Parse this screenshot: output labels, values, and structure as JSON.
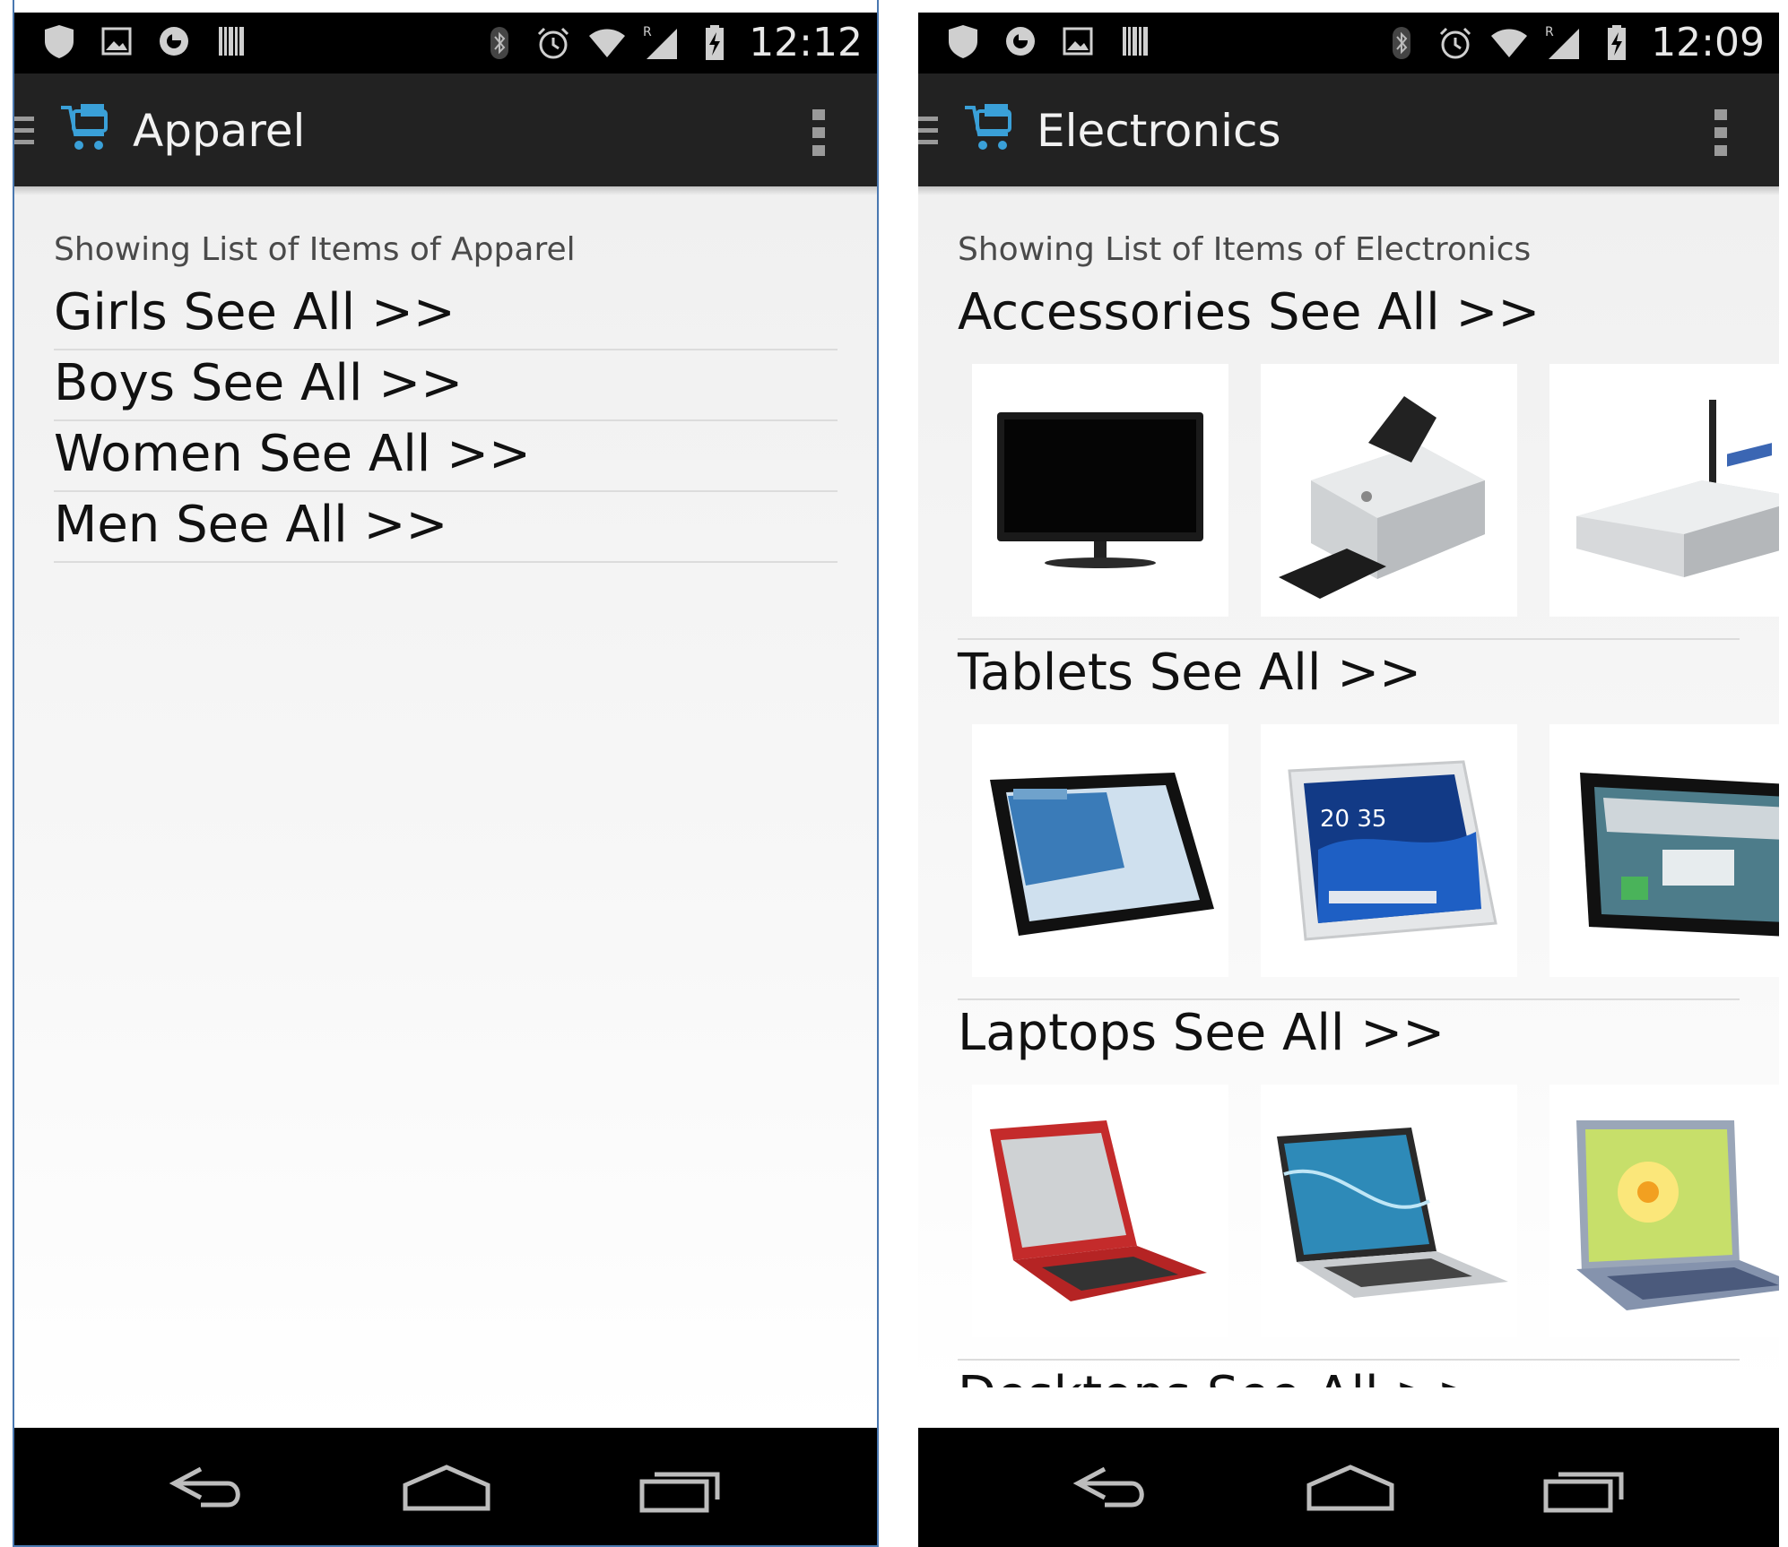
{
  "left": {
    "status": {
      "time": "12:12"
    },
    "action_bar": {
      "title": "Apparel"
    },
    "subtitle": "Showing List of Items of Apparel",
    "categories": [
      {
        "label": "Girls See All >>"
      },
      {
        "label": "Boys See All >>"
      },
      {
        "label": "Women See All >>"
      },
      {
        "label": "Men See All >>"
      }
    ]
  },
  "right": {
    "status": {
      "time": "12:09"
    },
    "action_bar": {
      "title": "Electronics"
    },
    "subtitle": "Showing List of Items of Electronics",
    "sections": [
      {
        "label": "Accessories See All >>",
        "items": [
          "tv-icon",
          "printer-icon",
          "router-icon"
        ]
      },
      {
        "label": "Tablets See All >>",
        "items": [
          "tablet-icon",
          "tablet-icon",
          "tablet-icon"
        ]
      },
      {
        "label": "Laptops See All >>",
        "items": [
          "laptop-icon",
          "laptop-icon",
          "laptop-icon"
        ]
      },
      {
        "label": "Desktops See All >>",
        "items": []
      }
    ]
  },
  "icons": {
    "status_left": [
      "shield-icon",
      "image-icon",
      "sync-icon",
      "barcode-icon"
    ],
    "status_right": [
      "bluetooth-icon",
      "alarm-icon",
      "wifi-icon",
      "signal-icon",
      "battery-icon"
    ],
    "nav": [
      "back-icon",
      "home-icon",
      "recents-icon"
    ]
  },
  "colors": {
    "action_bar": "#222222",
    "logo_accent": "#3aa0d8",
    "status_bar": "#000000"
  }
}
